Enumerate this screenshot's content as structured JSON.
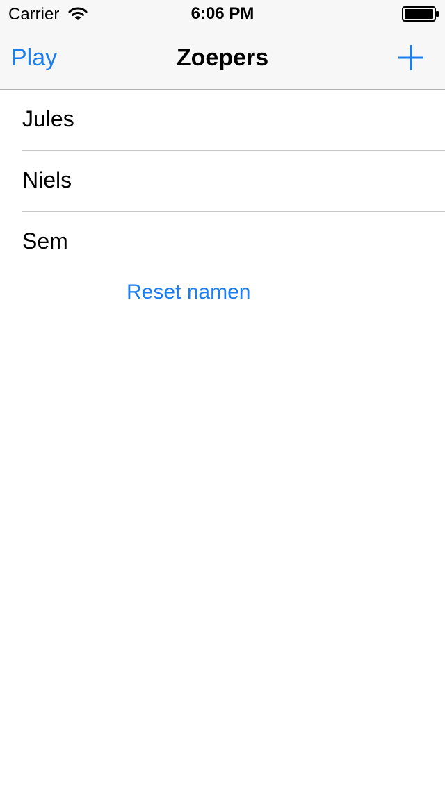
{
  "status_bar": {
    "carrier": "Carrier",
    "time": "6:06 PM"
  },
  "nav_bar": {
    "left_button": "Play",
    "title": "Zoepers",
    "right_icon": "plus-icon"
  },
  "players": [
    {
      "name": "Jules"
    },
    {
      "name": "Niels"
    },
    {
      "name": "Sem"
    }
  ],
  "reset_button": "Reset namen",
  "colors": {
    "accent": "#1a7ef0",
    "chrome_bg": "#f7f7f7",
    "separator": "#c8c7cc"
  }
}
